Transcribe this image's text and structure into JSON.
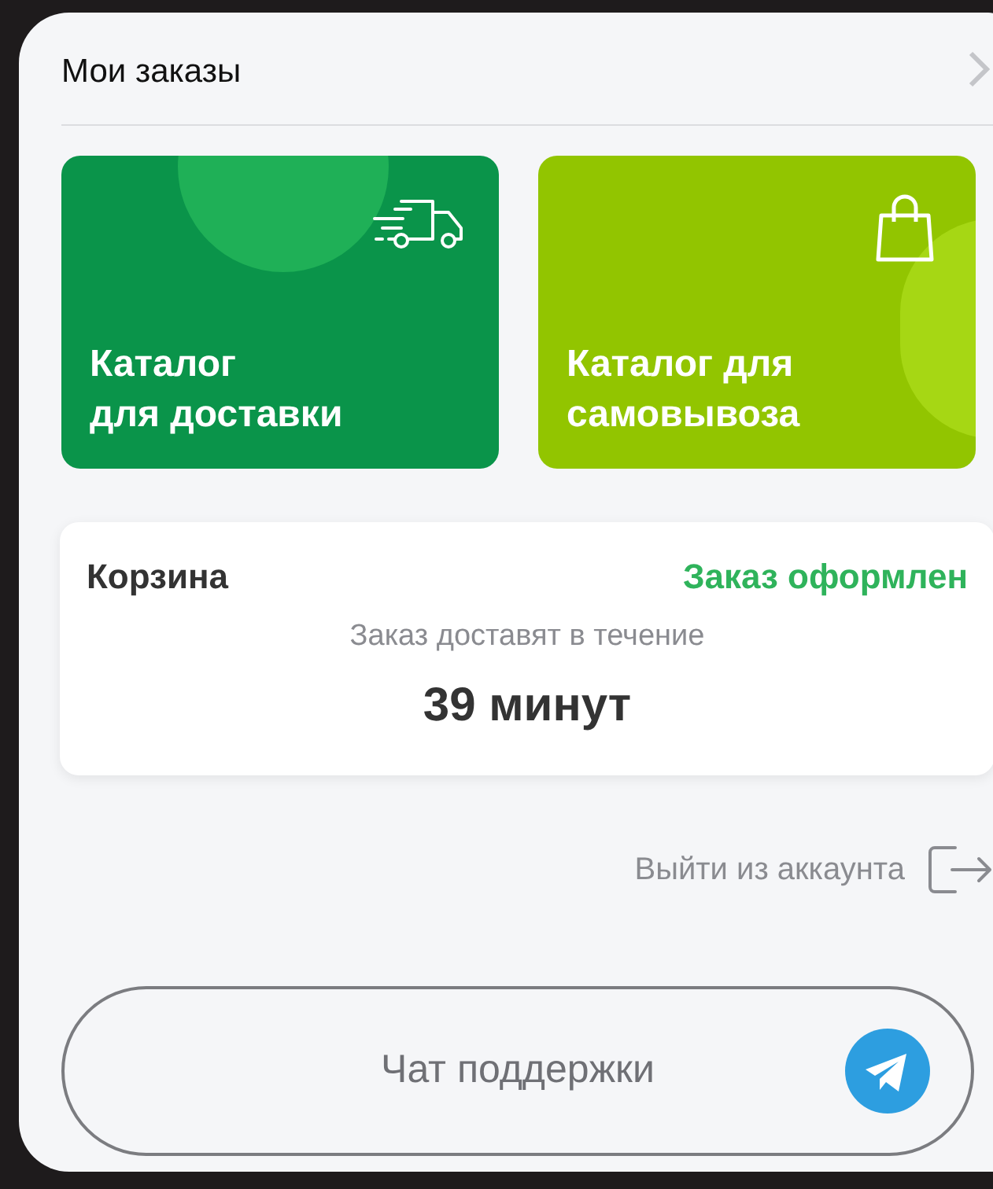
{
  "header": {
    "title": "Мои заказы"
  },
  "catalogs": [
    {
      "kind": "delivery",
      "label": "Каталог\nдля доставки"
    },
    {
      "kind": "pickup",
      "label": "Каталог для\nсамовывоза"
    }
  ],
  "cart": {
    "title": "Корзина",
    "status": "Заказ оформлен",
    "note": "Заказ доставят в течение",
    "eta": "39 минут"
  },
  "logout": {
    "label": "Выйти из аккаунта"
  },
  "support": {
    "label": "Чат поддержки"
  }
}
